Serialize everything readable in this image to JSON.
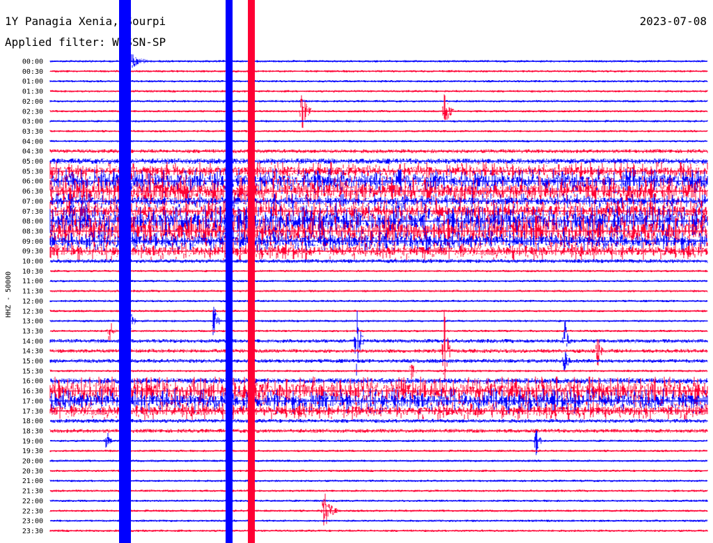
{
  "header": {
    "title": "1Y Panagia Xenia, Sourpi",
    "filter": "Applied filter: WWSSN-SP",
    "date": "2023-07-08"
  },
  "chart_data": {
    "type": "line",
    "chart_kind": "helicorder",
    "ylabel": "HHZ - 50000",
    "row_labels": [
      "00:00",
      "00:30",
      "01:00",
      "01:30",
      "02:00",
      "02:30",
      "03:00",
      "03:30",
      "04:00",
      "04:30",
      "05:00",
      "05:30",
      "06:00",
      "06:30",
      "07:00",
      "07:30",
      "08:00",
      "08:30",
      "09:00",
      "09:30",
      "10:00",
      "10:30",
      "11:00",
      "11:30",
      "12:00",
      "12:30",
      "13:00",
      "13:30",
      "14:00",
      "14:30",
      "15:00",
      "15:30",
      "16:00",
      "16:30",
      "17:00",
      "17:30",
      "18:00",
      "18:30",
      "19:00",
      "19:30",
      "20:00",
      "20:30",
      "21:00",
      "21:30",
      "22:00",
      "22:30",
      "23:00",
      "23:30"
    ],
    "colors": {
      "even_rows": "#0000ff",
      "odd_rows": "#ff0033"
    },
    "minutes_per_row": 30,
    "noise_level_by_row": [
      1,
      1,
      1,
      1,
      1,
      1,
      1,
      1,
      1,
      2,
      3,
      5,
      7,
      8,
      4,
      6,
      9,
      9,
      6,
      5,
      2,
      1,
      1,
      1,
      1,
      1,
      1,
      1,
      2,
      2,
      2,
      1,
      3,
      8,
      7,
      5,
      2,
      2,
      1,
      1,
      1,
      1,
      1,
      1,
      1,
      1,
      1,
      1
    ],
    "events": [
      {
        "row": 0,
        "minute": 3.5,
        "amp": 40,
        "dur": 30
      },
      {
        "row": 5,
        "minute": 18,
        "amp": 60,
        "dur": 15
      },
      {
        "row": 5,
        "minute": 11.5,
        "amp": 60,
        "dur": 15
      },
      {
        "row": 26,
        "minute": 3.5,
        "amp": 90,
        "dur": 12
      },
      {
        "row": 26,
        "minute": 7.5,
        "amp": 80,
        "dur": 8
      },
      {
        "row": 27,
        "minute": 2.7,
        "amp": 40,
        "dur": 12
      },
      {
        "row": 28,
        "minute": 14,
        "amp": 110,
        "dur": 10
      },
      {
        "row": 28,
        "minute": 23.5,
        "amp": 70,
        "dur": 8
      },
      {
        "row": 29,
        "minute": 18,
        "amp": 130,
        "dur": 10
      },
      {
        "row": 29,
        "minute": 25,
        "amp": 50,
        "dur": 8
      },
      {
        "row": 30,
        "minute": 23.5,
        "amp": 40,
        "dur": 8
      },
      {
        "row": 31,
        "minute": 16.5,
        "amp": 35,
        "dur": 8
      },
      {
        "row": 38,
        "minute": 2.6,
        "amp": 30,
        "dur": 8
      },
      {
        "row": 38,
        "minute": 22.2,
        "amp": 50,
        "dur": 8
      },
      {
        "row": 45,
        "minute": 12.5,
        "amp": 60,
        "dur": 20
      }
    ]
  }
}
